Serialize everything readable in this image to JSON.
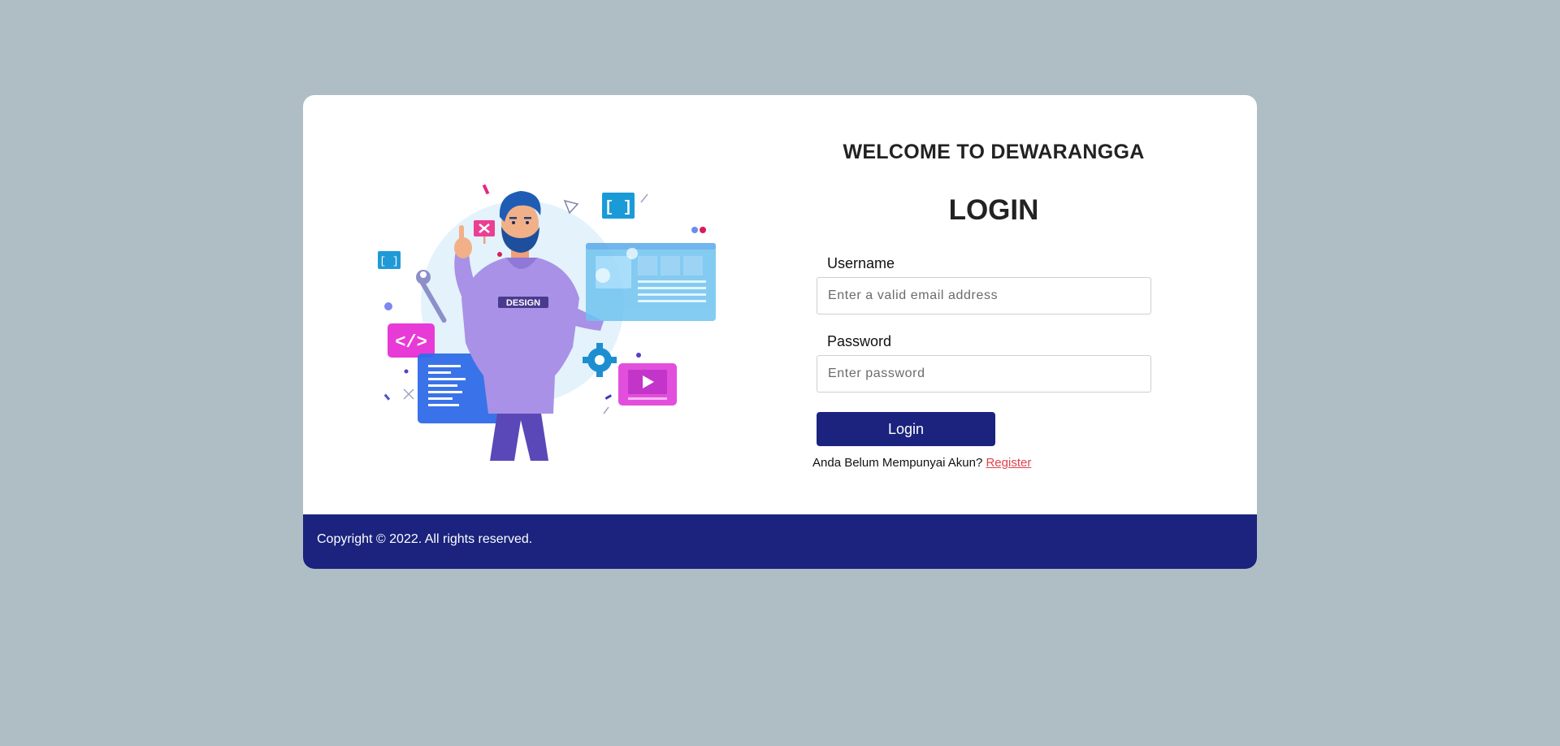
{
  "colors": {
    "background": "#afbdc5",
    "card": "#ffffff",
    "accent": "#1b237e",
    "link": "#e0434d"
  },
  "illustration": {
    "badge_text": "DESIGN",
    "icons": [
      "bracket-icon",
      "close-icon",
      "wrench-icon",
      "code-icon",
      "gear-icon",
      "play-icon",
      "browser-window-icon"
    ]
  },
  "form": {
    "welcome": "WELCOME TO DEWARANGGA",
    "title": "LOGIN",
    "username_label": "Username",
    "username_placeholder": "Enter a valid email address",
    "username_value": "",
    "password_label": "Password",
    "password_placeholder": "Enter password",
    "password_value": "",
    "login_button": "Login",
    "register_prompt": "Anda Belum Mempunyai Akun?",
    "register_link": "Register"
  },
  "footer": {
    "copyright": "Copyright © 2022. All rights reserved."
  }
}
